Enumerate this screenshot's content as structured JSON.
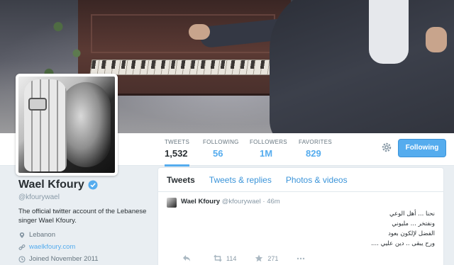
{
  "profile": {
    "name": "Wael Kfoury",
    "handle": "@kfourywael",
    "bio": "The official twitter account of the Lebanese singer Wael Kfoury.",
    "location": "Lebanon",
    "website": "waelkfoury.com",
    "joined": "Joined November 2011"
  },
  "stats": [
    {
      "label": "TWEETS",
      "value": "1,532"
    },
    {
      "label": "FOLLOWING",
      "value": "56"
    },
    {
      "label": "FOLLOWERS",
      "value": "1M"
    },
    {
      "label": "FAVORITES",
      "value": "829"
    }
  ],
  "follow_button": "Following",
  "tabs": [
    "Tweets",
    "Tweets & replies",
    "Photos & videos"
  ],
  "tweet": {
    "name": "Wael Kfoury",
    "handle": "@kfourywael",
    "time": "· 46m",
    "text": "نحنا ... أهل الوعي\nونفتخر ... مليوني\nالفضل لإلكون بعود\nورح يبقى .. دين عليي ....",
    "retweets": "114",
    "favorites": "271"
  },
  "colors": {
    "accent": "#55acee",
    "text": "#292f33",
    "muted": "#8899a6"
  },
  "icons": [
    "gear-icon",
    "verified-icon",
    "location-icon",
    "link-icon",
    "clock-icon",
    "reply-icon",
    "retweet-icon",
    "favorite-icon"
  ]
}
